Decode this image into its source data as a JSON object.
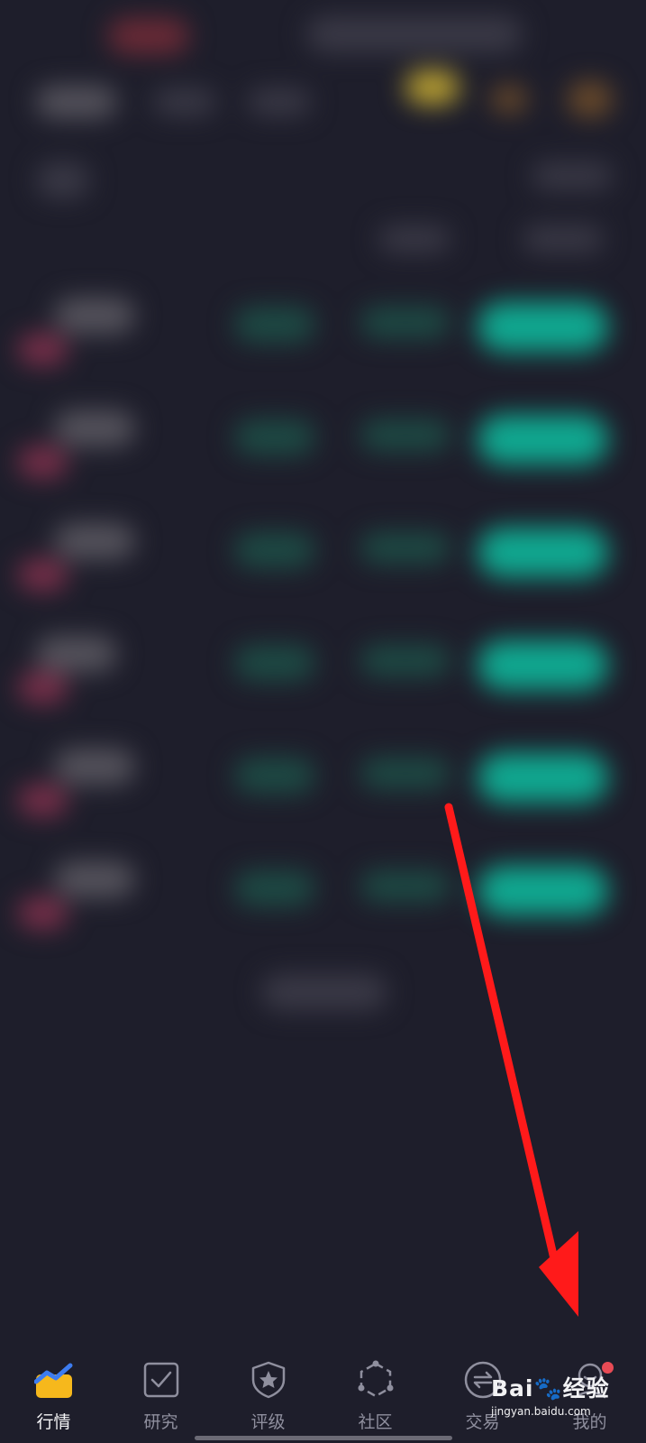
{
  "tabbar": {
    "tabs": [
      {
        "label": "行情",
        "icon": "market-chart-icon",
        "active": true
      },
      {
        "label": "研究",
        "icon": "checkbox-icon",
        "active": false
      },
      {
        "label": "评级",
        "icon": "shield-star-icon",
        "active": false
      },
      {
        "label": "社区",
        "icon": "hexagon-nodes-icon",
        "active": false
      },
      {
        "label": "交易",
        "icon": "exchange-circle-icon",
        "active": false
      },
      {
        "label": "我的",
        "icon": "profile-icon",
        "active": false,
        "badge": true
      }
    ],
    "active_color": "#f6b81c",
    "accent_blue": "#3d7cf0",
    "inactive_color": "#8f8f9e"
  },
  "annotation": {
    "arrow_color": "#ff1a1a",
    "target": "我的"
  },
  "watermark": {
    "brand": "Bai",
    "brand_cn": "经验",
    "url": "jingyan.baidu.com"
  },
  "colors": {
    "background": "#1e1e2b",
    "up_green": "#10a890",
    "badge_red": "#e84b55"
  }
}
